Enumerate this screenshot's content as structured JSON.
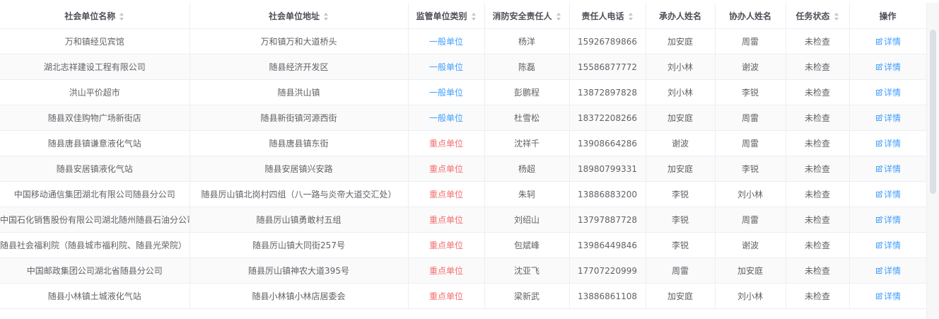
{
  "table": {
    "columns": [
      {
        "label": "社会单位名称",
        "sortable": true
      },
      {
        "label": "社会单位地址",
        "sortable": true
      },
      {
        "label": "监管单位类别",
        "sortable": true
      },
      {
        "label": "消防安全责任人",
        "sortable": true
      },
      {
        "label": "责任人电话",
        "sortable": true
      },
      {
        "label": "承办人姓名",
        "sortable": false
      },
      {
        "label": "协办人姓名",
        "sortable": false
      },
      {
        "label": "任务状态",
        "sortable": true
      },
      {
        "label": "操作",
        "sortable": false
      }
    ],
    "detail_label": "详情",
    "rows": [
      {
        "name": "万和镇经见宾馆",
        "address": "万和镇万和大道桥头",
        "category": "一般单位",
        "category_type": "normal",
        "person": "杨洋",
        "phone": "15926789866",
        "handler": "加安庭",
        "assistant": "周雷",
        "status": "未检查"
      },
      {
        "name": "湖北志祥建设工程有限公司",
        "address": "随县经济开发区",
        "category": "一般单位",
        "category_type": "normal",
        "person": "陈磊",
        "phone": "15586877772",
        "handler": "刘小林",
        "assistant": "谢波",
        "status": "未检查"
      },
      {
        "name": "洪山平价超市",
        "address": "随县洪山镇",
        "category": "一般单位",
        "category_type": "normal",
        "person": "彭鹏程",
        "phone": "13872897828",
        "handler": "刘小林",
        "assistant": "李锐",
        "status": "未检查"
      },
      {
        "name": "随县双佳购物广场新街店",
        "address": "随县新街镇河源西街",
        "category": "一般单位",
        "category_type": "normal",
        "person": "杜雪松",
        "phone": "18372208266",
        "handler": "加安庭",
        "assistant": "周雷",
        "status": "未检查"
      },
      {
        "name": "随县唐县镇谦意液化气站",
        "address": "随县唐县镇东街",
        "category": "重点单位",
        "category_type": "key",
        "person": "沈祥千",
        "phone": "13908664286",
        "handler": "谢波",
        "assistant": "周雷",
        "status": "未检查"
      },
      {
        "name": "随县安居镇液化气站",
        "address": "随县安居镇兴安路",
        "category": "重点单位",
        "category_type": "key",
        "person": "杨超",
        "phone": "18980799331",
        "handler": "加安庭",
        "assistant": "李锐",
        "status": "未检查"
      },
      {
        "name": "中国移动通信集团湖北有限公司随县分公司",
        "address": "随县厉山镇北岗村四组（八一路与炎帝大道交汇处）",
        "category": "重点单位",
        "category_type": "key",
        "person": "朱轲",
        "phone": "13886883200",
        "handler": "李锐",
        "assistant": "刘小林",
        "status": "未检查"
      },
      {
        "name": "中国石化销售股份有限公司湖北随州随县石油分公司",
        "address": "随县厉山镇勇敢村五组",
        "category": "重点单位",
        "category_type": "key",
        "person": "刘绍山",
        "phone": "13797887728",
        "handler": "李锐",
        "assistant": "周雷",
        "status": "未检查",
        "name_align": "left"
      },
      {
        "name": "随县社会福利院（随县城市福利院、随县光荣院）",
        "address": "随县厉山镇大同街257号",
        "category": "重点单位",
        "category_type": "key",
        "person": "包斌峰",
        "phone": "13986449846",
        "handler": "李锐",
        "assistant": "谢波",
        "status": "未检查",
        "name_align": "left"
      },
      {
        "name": "中国邮政集团公司湖北省随县分公司",
        "address": "随县厉山镇神农大道395号",
        "category": "重点单位",
        "category_type": "key",
        "person": "沈亚飞",
        "phone": "17707220999",
        "handler": "周雷",
        "assistant": "加安庭",
        "status": "未检查"
      },
      {
        "name": "随县小林镇土城液化气站",
        "address": "随县小林镇小林店居委会",
        "category": "重点单位",
        "category_type": "key",
        "person": "梁新武",
        "phone": "13886861108",
        "handler": "加安庭",
        "assistant": "刘小林",
        "status": "未检查"
      }
    ]
  },
  "colors": {
    "normal_category": "#409eff",
    "key_category": "#f56c6c",
    "link": "#409eff"
  },
  "icons": {
    "detail": "edit-icon",
    "sort": "sort-caret-icon"
  }
}
